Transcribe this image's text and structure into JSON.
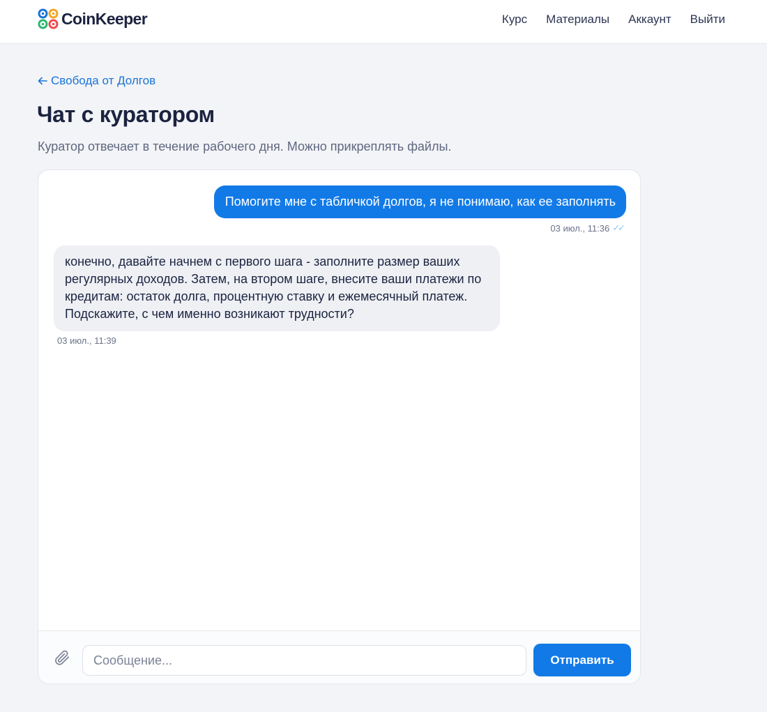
{
  "header": {
    "brand": "CoinKeeper",
    "nav": [
      {
        "label": "Курс"
      },
      {
        "label": "Материалы"
      },
      {
        "label": "Аккаунт"
      },
      {
        "label": "Выйти"
      }
    ]
  },
  "page": {
    "back_link": "Свобода от Долгов",
    "title": "Чат с куратором",
    "subtitle": "Куратор отвечает в течение рабочего дня. Можно прикреплять файлы."
  },
  "chat": {
    "messages": [
      {
        "direction": "outgoing",
        "text": "Помогите мне с табличкой долгов, я не понимаю, как ее заполнять",
        "time": "03 июл., 11:36",
        "status": "read"
      },
      {
        "direction": "incoming",
        "text": "конечно, давайте начнем с первого шага - заполните размер ваших регулярных доходов. Затем, на втором шаге, внесите ваши платежи по кредитам: остаток долга, процентную ставку и ежемесячный платеж. Подскажите, с чем именно возникают трудности?",
        "time": "03 июл., 11:39"
      }
    ],
    "composer": {
      "placeholder": "Сообщение...",
      "value": "",
      "send_label": "Отправить",
      "attach_icon": "paperclip-icon"
    }
  },
  "colors": {
    "accent": "#127ae6",
    "link": "#1a73d9",
    "page_bg": "#f3f4f7",
    "incoming_bubble": "#eef0f4",
    "read_check": "#8fc9ef"
  }
}
